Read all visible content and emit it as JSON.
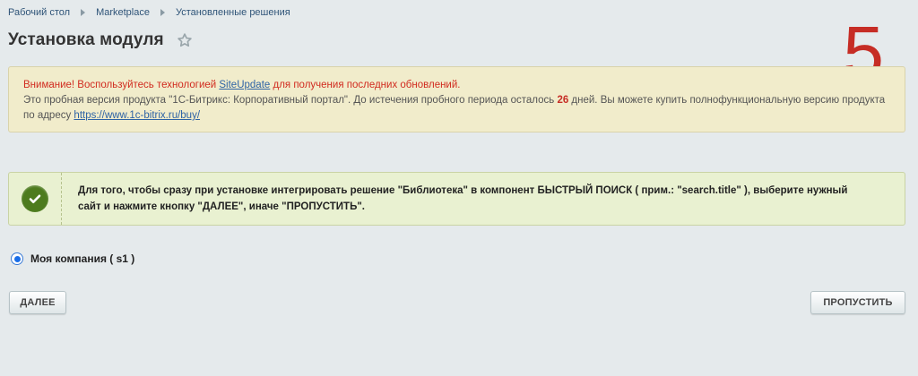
{
  "breadcrumb": [
    "Рабочий стол",
    "Marketplace",
    "Установленные решения"
  ],
  "page_title": "Установка модуля",
  "step_number": "5",
  "warning": {
    "line1_prefix": "Внимание! Воспользуйтесь технологией ",
    "line1_link": "SiteUpdate",
    "line1_suffix": " для получения последних обновлений.",
    "line2_prefix": "Это пробная версия продукта \"1С-Битрикс: Корпоративный портал\". До истечения пробного периода осталось ",
    "days": "26",
    "line2_suffix": " дней. Вы можете купить полнофункциональную версию продукта по адресу ",
    "buy_link": "https://www.1c-bitrix.ru/buy/"
  },
  "note": {
    "text_line1": "Для того, чтобы сразу при установке интегрировать решение \"Библиотека\" в компонент БЫСТРЫЙ ПОИСК ( прим.: \"search.title\" ), выберите нужный",
    "text_line2": "сайт и нажмите кнопку \"ДАЛЕЕ\", иначе \"ПРОПУСТИТЬ\"."
  },
  "site_option": {
    "label": "Моя компания ( s1 )",
    "checked": true
  },
  "buttons": {
    "next": "ДАЛЕЕ",
    "skip": "ПРОПУСТИТЬ"
  },
  "colors": {
    "warning_red": "#d12b1f",
    "link_blue": "#2e63a5",
    "check_green": "#4d7b1e",
    "step_red": "#c62d25"
  },
  "icons": {
    "favorite": "star-icon",
    "success": "check-icon"
  }
}
